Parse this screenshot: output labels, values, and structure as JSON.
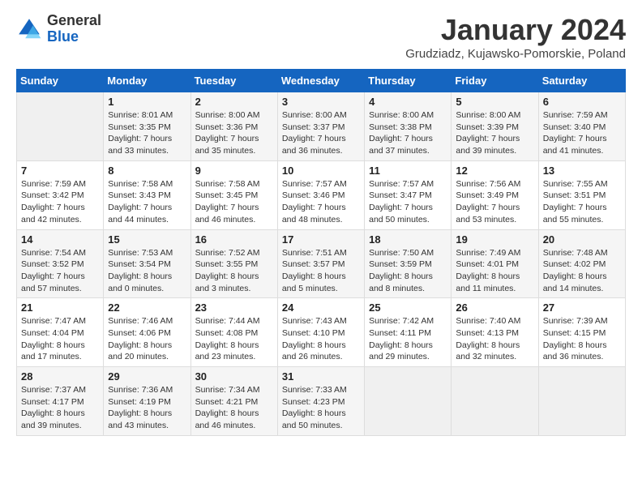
{
  "header": {
    "logo": {
      "general": "General",
      "blue": "Blue"
    },
    "title": "January 2024",
    "location": "Grudziadz, Kujawsko-Pomorskie, Poland"
  },
  "days_of_week": [
    "Sunday",
    "Monday",
    "Tuesday",
    "Wednesday",
    "Thursday",
    "Friday",
    "Saturday"
  ],
  "weeks": [
    [
      {
        "day": "",
        "info": ""
      },
      {
        "day": "1",
        "info": "Sunrise: 8:01 AM\nSunset: 3:35 PM\nDaylight: 7 hours\nand 33 minutes."
      },
      {
        "day": "2",
        "info": "Sunrise: 8:00 AM\nSunset: 3:36 PM\nDaylight: 7 hours\nand 35 minutes."
      },
      {
        "day": "3",
        "info": "Sunrise: 8:00 AM\nSunset: 3:37 PM\nDaylight: 7 hours\nand 36 minutes."
      },
      {
        "day": "4",
        "info": "Sunrise: 8:00 AM\nSunset: 3:38 PM\nDaylight: 7 hours\nand 37 minutes."
      },
      {
        "day": "5",
        "info": "Sunrise: 8:00 AM\nSunset: 3:39 PM\nDaylight: 7 hours\nand 39 minutes."
      },
      {
        "day": "6",
        "info": "Sunrise: 7:59 AM\nSunset: 3:40 PM\nDaylight: 7 hours\nand 41 minutes."
      }
    ],
    [
      {
        "day": "7",
        "info": "Sunrise: 7:59 AM\nSunset: 3:42 PM\nDaylight: 7 hours\nand 42 minutes."
      },
      {
        "day": "8",
        "info": "Sunrise: 7:58 AM\nSunset: 3:43 PM\nDaylight: 7 hours\nand 44 minutes."
      },
      {
        "day": "9",
        "info": "Sunrise: 7:58 AM\nSunset: 3:45 PM\nDaylight: 7 hours\nand 46 minutes."
      },
      {
        "day": "10",
        "info": "Sunrise: 7:57 AM\nSunset: 3:46 PM\nDaylight: 7 hours\nand 48 minutes."
      },
      {
        "day": "11",
        "info": "Sunrise: 7:57 AM\nSunset: 3:47 PM\nDaylight: 7 hours\nand 50 minutes."
      },
      {
        "day": "12",
        "info": "Sunrise: 7:56 AM\nSunset: 3:49 PM\nDaylight: 7 hours\nand 53 minutes."
      },
      {
        "day": "13",
        "info": "Sunrise: 7:55 AM\nSunset: 3:51 PM\nDaylight: 7 hours\nand 55 minutes."
      }
    ],
    [
      {
        "day": "14",
        "info": "Sunrise: 7:54 AM\nSunset: 3:52 PM\nDaylight: 7 hours\nand 57 minutes."
      },
      {
        "day": "15",
        "info": "Sunrise: 7:53 AM\nSunset: 3:54 PM\nDaylight: 8 hours\nand 0 minutes."
      },
      {
        "day": "16",
        "info": "Sunrise: 7:52 AM\nSunset: 3:55 PM\nDaylight: 8 hours\nand 3 minutes."
      },
      {
        "day": "17",
        "info": "Sunrise: 7:51 AM\nSunset: 3:57 PM\nDaylight: 8 hours\nand 5 minutes."
      },
      {
        "day": "18",
        "info": "Sunrise: 7:50 AM\nSunset: 3:59 PM\nDaylight: 8 hours\nand 8 minutes."
      },
      {
        "day": "19",
        "info": "Sunrise: 7:49 AM\nSunset: 4:01 PM\nDaylight: 8 hours\nand 11 minutes."
      },
      {
        "day": "20",
        "info": "Sunrise: 7:48 AM\nSunset: 4:02 PM\nDaylight: 8 hours\nand 14 minutes."
      }
    ],
    [
      {
        "day": "21",
        "info": "Sunrise: 7:47 AM\nSunset: 4:04 PM\nDaylight: 8 hours\nand 17 minutes."
      },
      {
        "day": "22",
        "info": "Sunrise: 7:46 AM\nSunset: 4:06 PM\nDaylight: 8 hours\nand 20 minutes."
      },
      {
        "day": "23",
        "info": "Sunrise: 7:44 AM\nSunset: 4:08 PM\nDaylight: 8 hours\nand 23 minutes."
      },
      {
        "day": "24",
        "info": "Sunrise: 7:43 AM\nSunset: 4:10 PM\nDaylight: 8 hours\nand 26 minutes."
      },
      {
        "day": "25",
        "info": "Sunrise: 7:42 AM\nSunset: 4:11 PM\nDaylight: 8 hours\nand 29 minutes."
      },
      {
        "day": "26",
        "info": "Sunrise: 7:40 AM\nSunset: 4:13 PM\nDaylight: 8 hours\nand 32 minutes."
      },
      {
        "day": "27",
        "info": "Sunrise: 7:39 AM\nSunset: 4:15 PM\nDaylight: 8 hours\nand 36 minutes."
      }
    ],
    [
      {
        "day": "28",
        "info": "Sunrise: 7:37 AM\nSunset: 4:17 PM\nDaylight: 8 hours\nand 39 minutes."
      },
      {
        "day": "29",
        "info": "Sunrise: 7:36 AM\nSunset: 4:19 PM\nDaylight: 8 hours\nand 43 minutes."
      },
      {
        "day": "30",
        "info": "Sunrise: 7:34 AM\nSunset: 4:21 PM\nDaylight: 8 hours\nand 46 minutes."
      },
      {
        "day": "31",
        "info": "Sunrise: 7:33 AM\nSunset: 4:23 PM\nDaylight: 8 hours\nand 50 minutes."
      },
      {
        "day": "",
        "info": ""
      },
      {
        "day": "",
        "info": ""
      },
      {
        "day": "",
        "info": ""
      }
    ]
  ]
}
